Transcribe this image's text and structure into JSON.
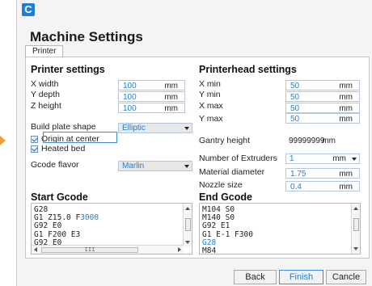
{
  "app": {
    "icon_letter": "C",
    "title": "Machine Settings"
  },
  "tabs": [
    {
      "label": "Printer"
    }
  ],
  "printer_settings": {
    "heading": "Printer settings",
    "fields": [
      {
        "label": "X width",
        "value": "100",
        "unit": "mm"
      },
      {
        "label": "Y depth",
        "value": "100",
        "unit": "mm"
      },
      {
        "label": "Z height",
        "value": "100",
        "unit": "mm"
      }
    ],
    "build_plate": {
      "label": "Build plate shape",
      "value": "Elliptic"
    },
    "origin_at_center": {
      "label": "Origin at center",
      "checked": true
    },
    "heated_bed": {
      "label": "Heated bed",
      "checked": true
    },
    "gcode_flavor": {
      "label": "Gcode flavor",
      "value": "Marlin"
    }
  },
  "printerhead_settings": {
    "heading": "Printerhead settings",
    "fields": [
      {
        "label": "X min",
        "value": "50",
        "unit": "mm"
      },
      {
        "label": "Y min",
        "value": "50",
        "unit": "mm"
      },
      {
        "label": "X max",
        "value": "50",
        "unit": "mm"
      },
      {
        "label": "Y max",
        "value": "50",
        "unit": "mm"
      }
    ],
    "gantry": {
      "label": "Gantry height",
      "value": "99999999",
      "unit": "mm"
    },
    "extruders": {
      "label": "Number of Extruders",
      "value": "1",
      "unit": "mm"
    },
    "material_diameter": {
      "label": "Material diameter",
      "value": "1.75",
      "unit": "mm"
    },
    "nozzle_size": {
      "label": "Nozzle size",
      "value": "0.4",
      "unit": "mm"
    }
  },
  "start_gcode": {
    "heading": "Start Gcode",
    "lines": [
      {
        "pre": "G28",
        "hl": ""
      },
      {
        "pre": "G1 Z15.0 F",
        "hl": "3000"
      },
      {
        "pre": "G92 E0",
        "hl": ""
      },
      {
        "pre": "G1 F200 E3",
        "hl": ""
      },
      {
        "pre": "G92 E0",
        "hl": ""
      }
    ],
    "hscroll_thumb": "III"
  },
  "end_gcode": {
    "heading": "End Gcode",
    "lines": [
      {
        "pre": "M104 S0",
        "hl": ""
      },
      {
        "pre": "M140 S0",
        "hl": ""
      },
      {
        "pre": "G92 E1",
        "hl": ""
      },
      {
        "pre": "G1 E-1 F300",
        "hl": ""
      },
      {
        "pre": "",
        "hl": "G28"
      },
      {
        "pre": "M84",
        "hl": ""
      }
    ]
  },
  "footer": {
    "back": "Back",
    "finish": "Finish",
    "cancel": "Cancle"
  },
  "colors": {
    "accent": "#1d7fd6",
    "marker": "#f0a030"
  }
}
